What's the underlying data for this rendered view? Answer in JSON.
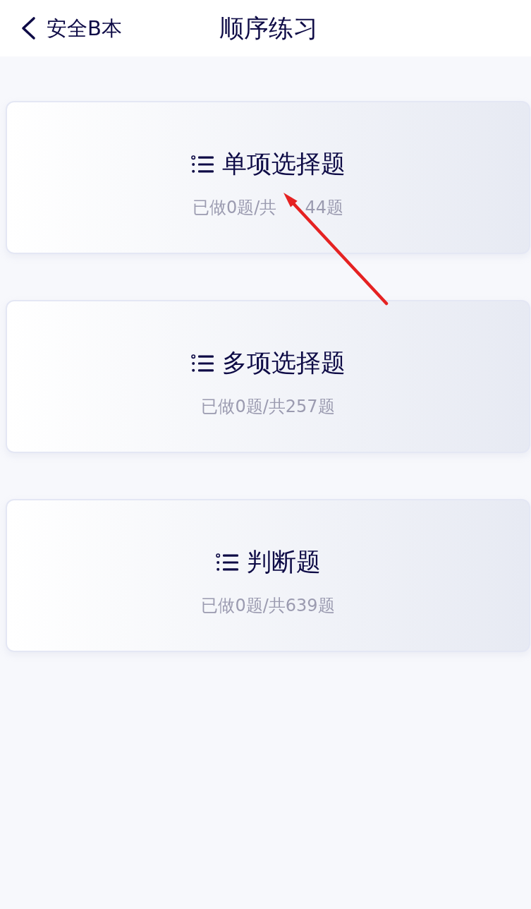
{
  "header": {
    "back_label": "安全B本",
    "title": "顺序练习"
  },
  "cards": [
    {
      "title": "单项选择题",
      "progress": [
        "已做0题/共",
        "44题"
      ]
    },
    {
      "title": "多项选择题",
      "progress": [
        "已做0题/共257题"
      ]
    },
    {
      "title": "判断题",
      "progress": [
        "已做0题/共639题"
      ]
    }
  ]
}
